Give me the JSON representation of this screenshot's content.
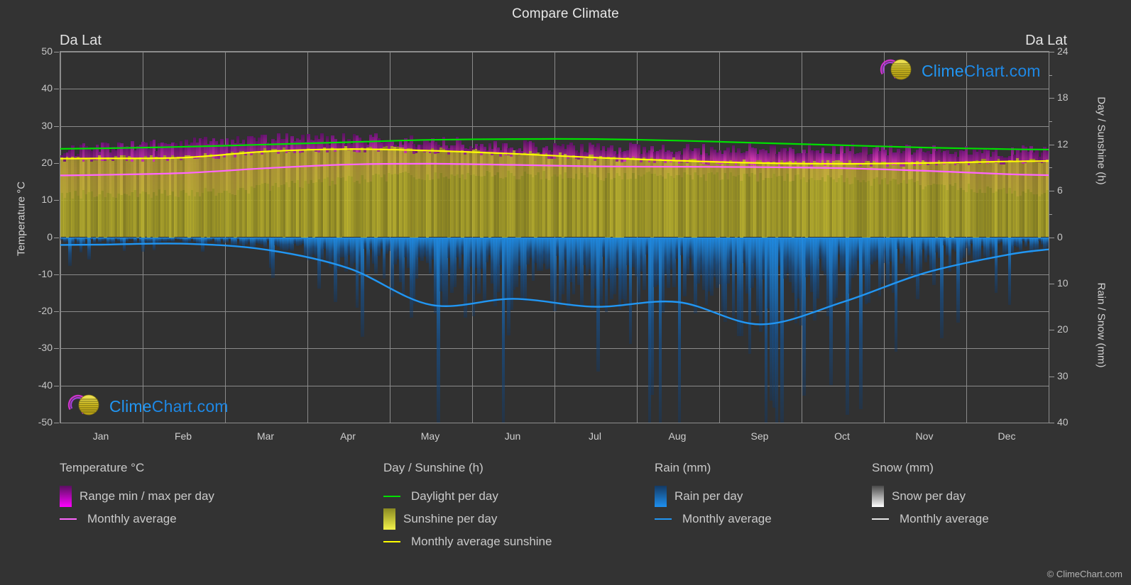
{
  "header": {
    "title": "Compare Climate",
    "location_left": "Da Lat",
    "location_right": "Da Lat"
  },
  "branding": {
    "logo_text_a": "Clime",
    "logo_text_b": "Chart.com",
    "copyright": "© ClimeChart.com",
    "logo_arc_color": "#cc33cc",
    "logo_sphere_color": "#d8c832",
    "logo_text_color": "#2196f3"
  },
  "axes": {
    "left_title": "Temperature °C",
    "left_ticks": [
      "50",
      "40",
      "30",
      "20",
      "10",
      "0",
      "-10",
      "-20",
      "-30",
      "-40",
      "-50"
    ],
    "left_values": [
      50,
      40,
      30,
      20,
      10,
      0,
      -10,
      -20,
      -30,
      -40,
      -50
    ],
    "right_top_title": "Day / Sunshine (h)",
    "right_top_ticks": [
      "24",
      "18",
      "12",
      "6",
      "0"
    ],
    "right_top_values": [
      24,
      18,
      12,
      6,
      0
    ],
    "right_bottom_title": "Rain / Snow (mm)",
    "right_bottom_ticks": [
      "0",
      "10",
      "20",
      "30",
      "40"
    ],
    "right_bottom_values": [
      0,
      10,
      20,
      30,
      40
    ],
    "x_ticks": [
      "Jan",
      "Feb",
      "Mar",
      "Apr",
      "May",
      "Jun",
      "Jul",
      "Aug",
      "Sep",
      "Oct",
      "Nov",
      "Dec"
    ]
  },
  "legend": {
    "groups": [
      {
        "title": "Temperature °C",
        "items": [
          {
            "label": "Range min / max per day",
            "marker": "gradient-box",
            "color": "#ff00ff",
            "color2": "#5a1060"
          },
          {
            "label": "Monthly average",
            "marker": "line",
            "color": "#ff66ff"
          }
        ]
      },
      {
        "title": "Day / Sunshine (h)",
        "items": [
          {
            "label": "Daylight per day",
            "marker": "line",
            "color": "#00e000"
          },
          {
            "label": "Sunshine per day",
            "marker": "gradient-box",
            "color": "#f2f24a",
            "color2": "#8a8a22"
          },
          {
            "label": "Monthly average sunshine",
            "marker": "line",
            "color": "#ffff00"
          }
        ]
      },
      {
        "title": "Rain (mm)",
        "items": [
          {
            "label": "Rain per day",
            "marker": "gradient-box",
            "color": "#1e90f0",
            "color2": "#143a63"
          },
          {
            "label": "Monthly average",
            "marker": "line",
            "color": "#2196f3"
          }
        ]
      },
      {
        "title": "Snow (mm)",
        "items": [
          {
            "label": "Snow per day",
            "marker": "gradient-box",
            "color": "#ffffff",
            "color2": "#4a4a4a"
          },
          {
            "label": "Monthly average",
            "marker": "line",
            "color": "#e8e8e8"
          }
        ]
      }
    ]
  },
  "chart_data": {
    "type": "area",
    "title": "Compare Climate",
    "subtitle": "Da Lat",
    "location": "Da Lat",
    "xlabel": "",
    "ylabel": "Temperature °C",
    "ylim": [
      -50,
      50
    ],
    "y2lim_top_hours": [
      0,
      24
    ],
    "y2lim_bottom_mm": [
      0,
      40
    ],
    "grid": true,
    "legend_position": "below",
    "categories": [
      "Jan",
      "Feb",
      "Mar",
      "Apr",
      "May",
      "Jun",
      "Jul",
      "Aug",
      "Sep",
      "Oct",
      "Nov",
      "Dec"
    ],
    "series": [
      {
        "name": "Monthly average temperature",
        "unit": "°C",
        "axis": "left",
        "color": "#ff66ff",
        "values": [
          16.8,
          17.3,
          18.6,
          19.6,
          19.8,
          19.5,
          19.1,
          19.0,
          18.9,
          18.6,
          17.9,
          17.0
        ]
      },
      {
        "name": "Range min per day",
        "unit": "°C",
        "axis": "left",
        "color": "#ff00ff",
        "values": [
          11.5,
          11.8,
          13.4,
          15.6,
          16.6,
          16.7,
          16.4,
          16.4,
          16.2,
          15.5,
          14.2,
          12.4
        ]
      },
      {
        "name": "Range max per day",
        "unit": "°C",
        "axis": "left",
        "color": "#ff00ff",
        "values": [
          23.8,
          25.0,
          26.2,
          26.4,
          25.6,
          24.4,
          23.9,
          23.6,
          23.9,
          23.6,
          23.2,
          22.8
        ]
      },
      {
        "name": "Daylight per day",
        "unit": "h",
        "axis": "right-top",
        "color": "#00e000",
        "values": [
          11.5,
          11.7,
          12.0,
          12.3,
          12.6,
          12.7,
          12.7,
          12.5,
          12.2,
          11.9,
          11.6,
          11.4
        ]
      },
      {
        "name": "Monthly average sunshine",
        "unit": "h",
        "axis": "right-top",
        "color": "#ffff00",
        "values": [
          10.2,
          10.3,
          11.1,
          11.4,
          11.2,
          10.8,
          10.3,
          9.9,
          9.6,
          9.5,
          9.6,
          9.8
        ]
      },
      {
        "name": "Rain monthly average",
        "unit": "mm",
        "axis": "right-bottom",
        "color": "#2196f3",
        "values": [
          1.6,
          1.4,
          2.7,
          6.7,
          14.6,
          13.3,
          15.0,
          14.0,
          18.8,
          14.0,
          7.7,
          3.8
        ]
      },
      {
        "name": "Snow monthly average",
        "unit": "mm",
        "axis": "right-bottom",
        "color": "#e8e8e8",
        "values": [
          0,
          0,
          0,
          0,
          0,
          0,
          0,
          0,
          0,
          0,
          0,
          0
        ]
      }
    ]
  }
}
